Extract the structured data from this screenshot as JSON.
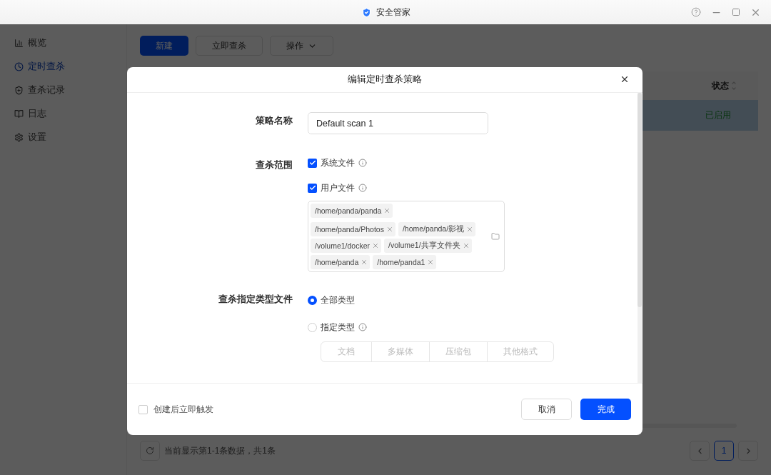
{
  "window": {
    "title": "安全管家"
  },
  "sidebar": {
    "items": [
      {
        "label": "概览",
        "selected": false
      },
      {
        "label": "定时查杀",
        "selected": true
      },
      {
        "label": "查杀记录",
        "selected": false
      },
      {
        "label": "日志",
        "selected": false
      },
      {
        "label": "设置",
        "selected": false
      }
    ]
  },
  "toolbar": {
    "buttons": [
      {
        "label": "新建",
        "kind": "primary"
      },
      {
        "label": "立即查杀",
        "kind": "default"
      },
      {
        "label": "操作",
        "kind": "dropdown"
      }
    ]
  },
  "table": {
    "columns": [
      "状态"
    ],
    "rows": [
      {
        "status": "已启用",
        "selected": true
      }
    ]
  },
  "footer": {
    "summary": "当前显示第1-1条数据，共1条",
    "page": "1"
  },
  "dialog": {
    "title": "编辑定时查杀策略",
    "name_field": {
      "label": "策略名称",
      "value": "Default scan 1"
    },
    "scope": {
      "label": "查杀范围",
      "options": [
        {
          "label": "系统文件",
          "checked": true
        },
        {
          "label": "用户文件",
          "checked": true
        }
      ],
      "paths": [
        "/home/panda/panda",
        "/home/panda/Photos",
        "/home/panda/影视",
        "/volume1/docker",
        "/volume1/共享文件夹",
        "/home/panda",
        "/home/panda1"
      ]
    },
    "file_types": {
      "label": "查杀指定类型文件",
      "options": [
        {
          "label": "全部类型",
          "selected": true,
          "info": false
        },
        {
          "label": "指定类型",
          "selected": false,
          "info": true
        }
      ],
      "segments": {
        "disabled": true,
        "items": [
          "文档",
          "多媒体",
          "压缩包",
          "其他格式"
        ]
      }
    },
    "trigger": {
      "label": "创建后立即触发",
      "checked": false
    },
    "buttons": [
      {
        "label": "取消",
        "kind": "default"
      },
      {
        "label": "完成",
        "kind": "primary"
      }
    ]
  }
}
